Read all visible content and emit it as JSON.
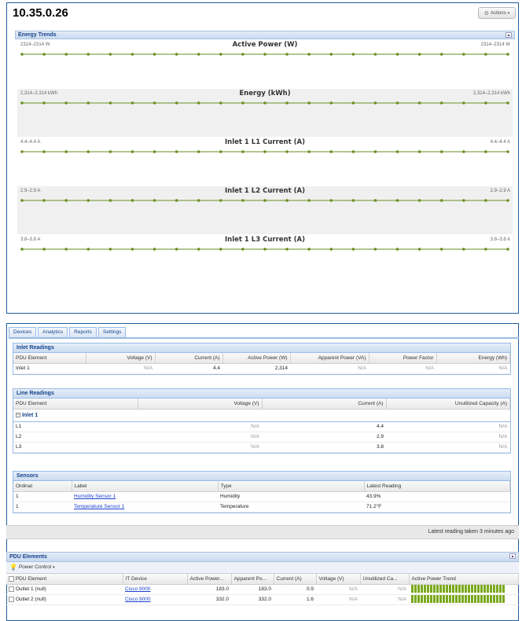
{
  "device": {
    "title": "10.35.0.26",
    "actions_label": "Actions"
  },
  "trends": {
    "header": "Energy Trends",
    "charts": [
      {
        "title": "Active Power (W)",
        "range_left": "2314–2314 W",
        "range_right": "2314–2314 W"
      },
      {
        "title": "Energy (kWh)",
        "range_left": "2,314–2,314 kWh",
        "range_right": "2,314–2,314 kWh"
      },
      {
        "title": "Inlet 1 L1 Current (A)",
        "range_left": "4.4–4.4 A",
        "range_right": "4.4–4.4 A"
      },
      {
        "title": "Inlet 1 L2 Current (A)",
        "range_left": "2.9–2.9 A",
        "range_right": "2.9–2.9 A"
      },
      {
        "title": "Inlet 1 L3 Current (A)",
        "range_left": "3.8–3.8 A",
        "range_right": "3.8–3.8 A"
      }
    ],
    "line_color": "#6b8e23",
    "point_count": 23
  },
  "tabs": [
    "Devices",
    "Analytics",
    "Reports",
    "Settings"
  ],
  "inlet_readings": {
    "header": "Inlet Readings",
    "columns": [
      "PDU Element",
      "Voltage (V)",
      "Current (A)",
      "Active Power (W)",
      "Apparent Power (VA)",
      "Power Factor",
      "Energy (Wh)"
    ],
    "rows": [
      [
        "Inlet 1",
        "N/A",
        "4.4",
        "2,314",
        "N/A",
        "N/A",
        "N/A"
      ]
    ]
  },
  "line_readings": {
    "header": "Line Readings",
    "columns": [
      "PDU Element",
      "Voltage (V)",
      "Current (A)",
      "Unutilized Capacity (A)"
    ],
    "group": "Inlet 1",
    "rows": [
      [
        "L1",
        "N/A",
        "4.4",
        "N/A"
      ],
      [
        "L2",
        "N/A",
        "2.9",
        "N/A"
      ],
      [
        "L3",
        "N/A",
        "3.8",
        "N/A"
      ]
    ]
  },
  "sensors": {
    "header": "Sensors",
    "columns": [
      "Ordinal",
      "Label",
      "Type",
      "Latest Reading"
    ],
    "rows": [
      [
        "1",
        "Humidity Sensor 1",
        "Humidity",
        "43.9%"
      ],
      [
        "1",
        "Temperature Sensor 1",
        "Temperature",
        "71.2°F"
      ]
    ]
  },
  "latest_reading": "Latest reading taken 3 minutes ago",
  "pdu_elements": {
    "header": "PDU Elements",
    "power_control": "Power Control",
    "columns": [
      "PDU Element",
      "IT Device",
      "Active Power...",
      "Apparent Po...",
      "Current (A)",
      "Voltage (V)",
      "Unutilized Ca...",
      "Active Power Trend"
    ],
    "rows": [
      [
        "Outlet 1 (null)",
        "Cisco 9000",
        "183.0",
        "183.0",
        "0.9",
        "N/A",
        "N/A"
      ],
      [
        "Outlet 2 (null)",
        "Cisco 9000",
        "332.0",
        "332.0",
        "1.6",
        "N/A",
        "N/A"
      ]
    ],
    "trend_bar_color": "#7aa81e"
  }
}
